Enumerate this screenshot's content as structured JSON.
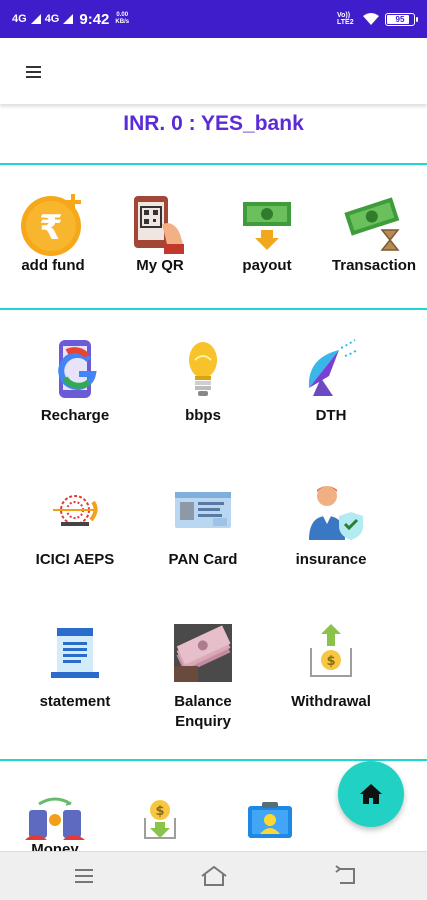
{
  "status_bar": {
    "net1": "4G",
    "net2": "4G",
    "time": "9:42",
    "speed_value": "0.00",
    "speed_unit": "KB/s",
    "volte": "Vo)) LTE2",
    "battery": "95"
  },
  "balance": {
    "text": "INR. 0 : YES_bank"
  },
  "quick_actions": [
    {
      "label": "add fund",
      "icon": "rupee-add-icon"
    },
    {
      "label": "My QR",
      "icon": "qr-phone-icon"
    },
    {
      "label": "payout",
      "icon": "cash-payout-icon"
    },
    {
      "label": "Transaction",
      "icon": "cash-hourglass-icon"
    }
  ],
  "services": [
    {
      "label": "Recharge",
      "icon": "phone-recharge-icon"
    },
    {
      "label": "bbps",
      "icon": "bulb-icon"
    },
    {
      "label": "DTH",
      "icon": "satellite-dish-icon"
    },
    {
      "label": "ICICI AEPS",
      "icon": "aadhaar-icon"
    },
    {
      "label": "PAN Card",
      "icon": "pan-card-icon"
    },
    {
      "label": "insurance",
      "icon": "insurance-person-icon"
    },
    {
      "label": "statement",
      "icon": "statement-icon"
    },
    {
      "label": "Balance Enquiry",
      "label_line1": "Balance",
      "label_line2": "Enquiry",
      "icon": "cash-stack-photo-icon"
    },
    {
      "label": "Withdrawal",
      "icon": "withdrawal-icon"
    }
  ],
  "bottom_row": [
    {
      "label": "Money",
      "icon": "money-transfer-icon"
    },
    {
      "icon": "payout-box-icon"
    },
    {
      "icon": "id-card-icon"
    }
  ],
  "colors": {
    "status_bar": "#3f1dcb",
    "accent_text": "#5a2bd6",
    "divider": "#1fd6d2",
    "fab": "#21d2c4"
  }
}
